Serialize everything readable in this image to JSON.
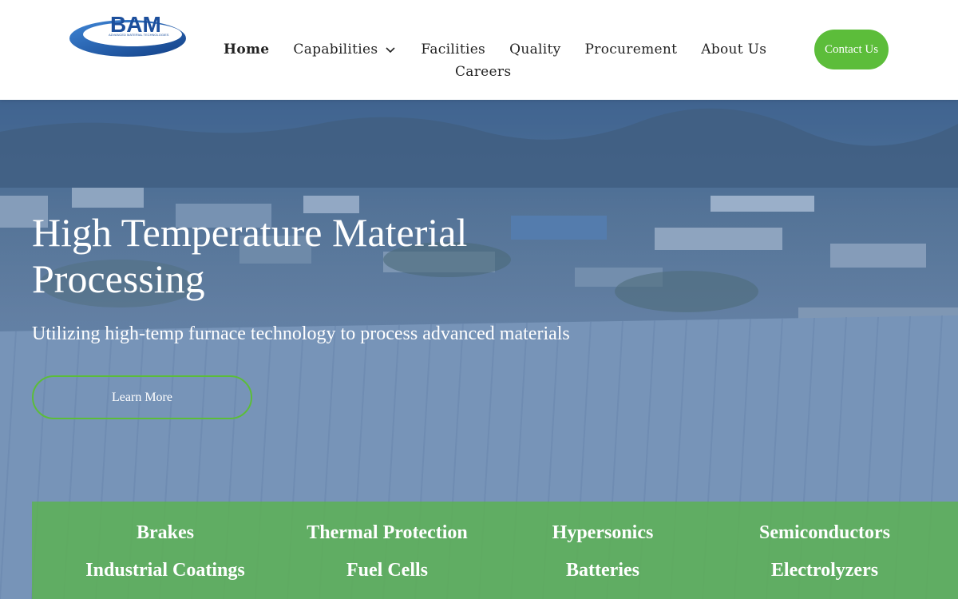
{
  "logo": {
    "text": "BAM",
    "tagline": "ADVANCED MATERIAL TECHNOLOGIES",
    "alt": "BAM logo"
  },
  "nav": {
    "items": [
      {
        "label": "Home"
      },
      {
        "label": "Capabilities"
      },
      {
        "label": "Facilities"
      },
      {
        "label": "Quality"
      },
      {
        "label": "Procurement"
      },
      {
        "label": "About Us"
      },
      {
        "label": "Careers"
      }
    ]
  },
  "header": {
    "contact_label": "Contact Us"
  },
  "hero": {
    "title": "High Temperature Material Processing",
    "subtitle": "Utilizing high-temp furnace technology to process advanced materials",
    "cta_label": "Learn More"
  },
  "markets": [
    {
      "label": "Brakes"
    },
    {
      "label": "Thermal Protection"
    },
    {
      "label": "Hypersonics"
    },
    {
      "label": "Semiconductors"
    },
    {
      "label": "Industrial Coatings"
    },
    {
      "label": "Fuel Cells"
    },
    {
      "label": "Batteries"
    },
    {
      "label": "Electrolyzers"
    }
  ],
  "colors": {
    "accent_green": "#5cbd3a",
    "brand_blue": "#1e5aa8",
    "hero_tint": "#466ea5"
  },
  "icons": {
    "dropdown": "chevron-down-icon"
  }
}
